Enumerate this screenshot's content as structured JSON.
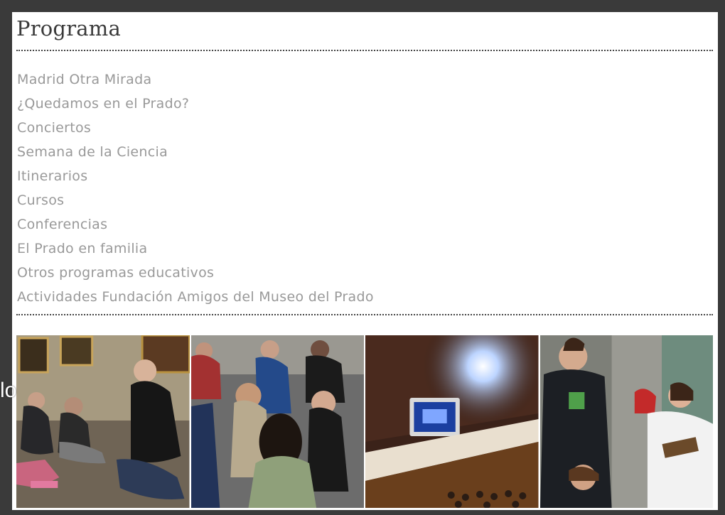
{
  "section": {
    "title": "Programa"
  },
  "menu": [
    {
      "label": "Madrid Otra Mirada"
    },
    {
      "label": "¿Quedamos en el Prado?"
    },
    {
      "label": "Conciertos"
    },
    {
      "label": "Semana de la Ciencia"
    },
    {
      "label": "Itinerarios"
    },
    {
      "label": "Cursos"
    },
    {
      "label": "Conferencias"
    },
    {
      "label": "El Prado en familia"
    },
    {
      "label": "Otros programas educativos"
    },
    {
      "label": "Actividades Fundación Amigos del Museo del Prado"
    }
  ],
  "photos": [
    {
      "icon": "gallery-family-workshop-photo"
    },
    {
      "icon": "student-group-visit-photo"
    },
    {
      "icon": "auditorium-projector-photo"
    },
    {
      "icon": "students-with-notebooks-photo"
    }
  ],
  "overlay": {
    "text": "lo"
  },
  "colors": {
    "background": "#3a3a3a",
    "panel": "#ffffff",
    "title": "#3a3a3a",
    "link": "#999999",
    "separator": "#444444"
  }
}
